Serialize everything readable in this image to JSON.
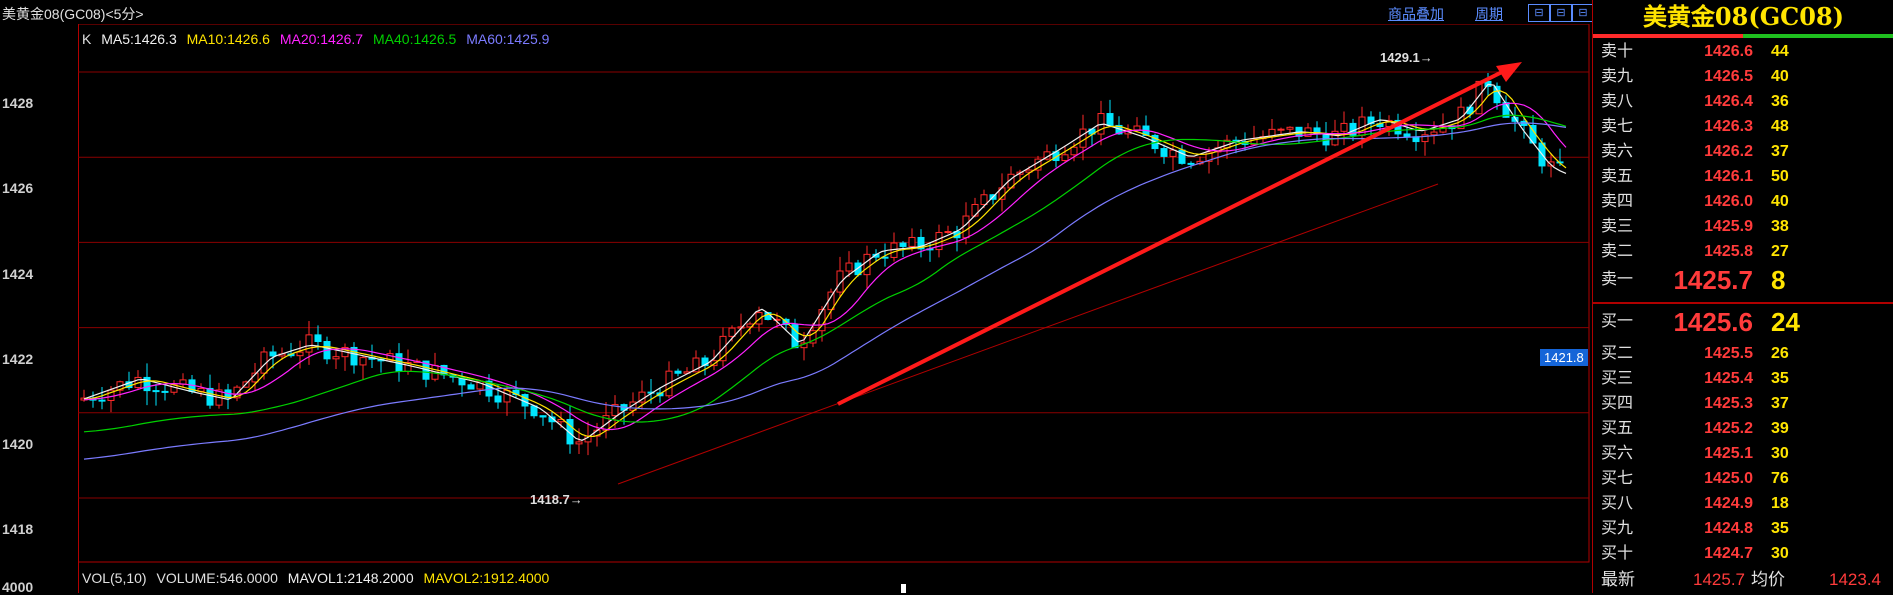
{
  "window": {
    "title": "美黄金08(GC08)<5分>"
  },
  "toolbar": {
    "overlay_label": "商品叠加",
    "period_label": "周期",
    "btn1": "⊟",
    "btn2": "⊟",
    "btn3": "⊟"
  },
  "ma_legend": {
    "k": "K",
    "ma5": "MA5:1426.3",
    "ma10": "MA10:1426.6",
    "ma20": "MA20:1426.7",
    "ma40": "MA40:1426.5",
    "ma60": "MA60:1425.9"
  },
  "vol_legend": {
    "vol": "VOL(5,10)",
    "volume": "VOLUME:546.0000",
    "mavol1": "MAVOL1:2148.2000",
    "mavol2": "MAVOL2:1912.4000"
  },
  "colors": {
    "up": "#ff2a2a",
    "down": "#00e6ff",
    "ma5": "#f0f0f0",
    "ma10": "#ffe400",
    "ma20": "#ff22ff",
    "ma40": "#00d000",
    "ma60": "#7b7bff",
    "grid": "#a00000"
  },
  "y_ticks": [
    "1428",
    "1426",
    "1424",
    "1422",
    "1420",
    "1418",
    "4000"
  ],
  "annotations": {
    "high": "1429.1→",
    "low": "1418.7→",
    "current_price_tag": "1421.8"
  },
  "orderbook": {
    "title": "美黄金08(GC08)",
    "asks": [
      {
        "label": "卖十",
        "price": "1426.6",
        "qty": "44"
      },
      {
        "label": "卖九",
        "price": "1426.5",
        "qty": "40"
      },
      {
        "label": "卖八",
        "price": "1426.4",
        "qty": "36"
      },
      {
        "label": "卖七",
        "price": "1426.3",
        "qty": "48"
      },
      {
        "label": "卖六",
        "price": "1426.2",
        "qty": "37"
      },
      {
        "label": "卖五",
        "price": "1426.1",
        "qty": "50"
      },
      {
        "label": "卖四",
        "price": "1426.0",
        "qty": "40"
      },
      {
        "label": "卖三",
        "price": "1425.9",
        "qty": "38"
      },
      {
        "label": "卖二",
        "price": "1425.8",
        "qty": "27"
      },
      {
        "label": "卖一",
        "price": "1425.7",
        "qty": "8"
      }
    ],
    "bids": [
      {
        "label": "买一",
        "price": "1425.6",
        "qty": "24"
      },
      {
        "label": "买二",
        "price": "1425.5",
        "qty": "26"
      },
      {
        "label": "买三",
        "price": "1425.4",
        "qty": "35"
      },
      {
        "label": "买四",
        "price": "1425.3",
        "qty": "37"
      },
      {
        "label": "买五",
        "price": "1425.2",
        "qty": "39"
      },
      {
        "label": "买六",
        "price": "1425.1",
        "qty": "30"
      },
      {
        "label": "买七",
        "price": "1425.0",
        "qty": "76"
      },
      {
        "label": "买八",
        "price": "1424.9",
        "qty": "18"
      },
      {
        "label": "买九",
        "price": "1424.8",
        "qty": "35"
      },
      {
        "label": "买十",
        "price": "1424.7",
        "qty": "30"
      }
    ],
    "latest_label": "最新",
    "latest_value": "1425.7",
    "avg_label": "均价",
    "avg_value": "1423.4"
  }
}
